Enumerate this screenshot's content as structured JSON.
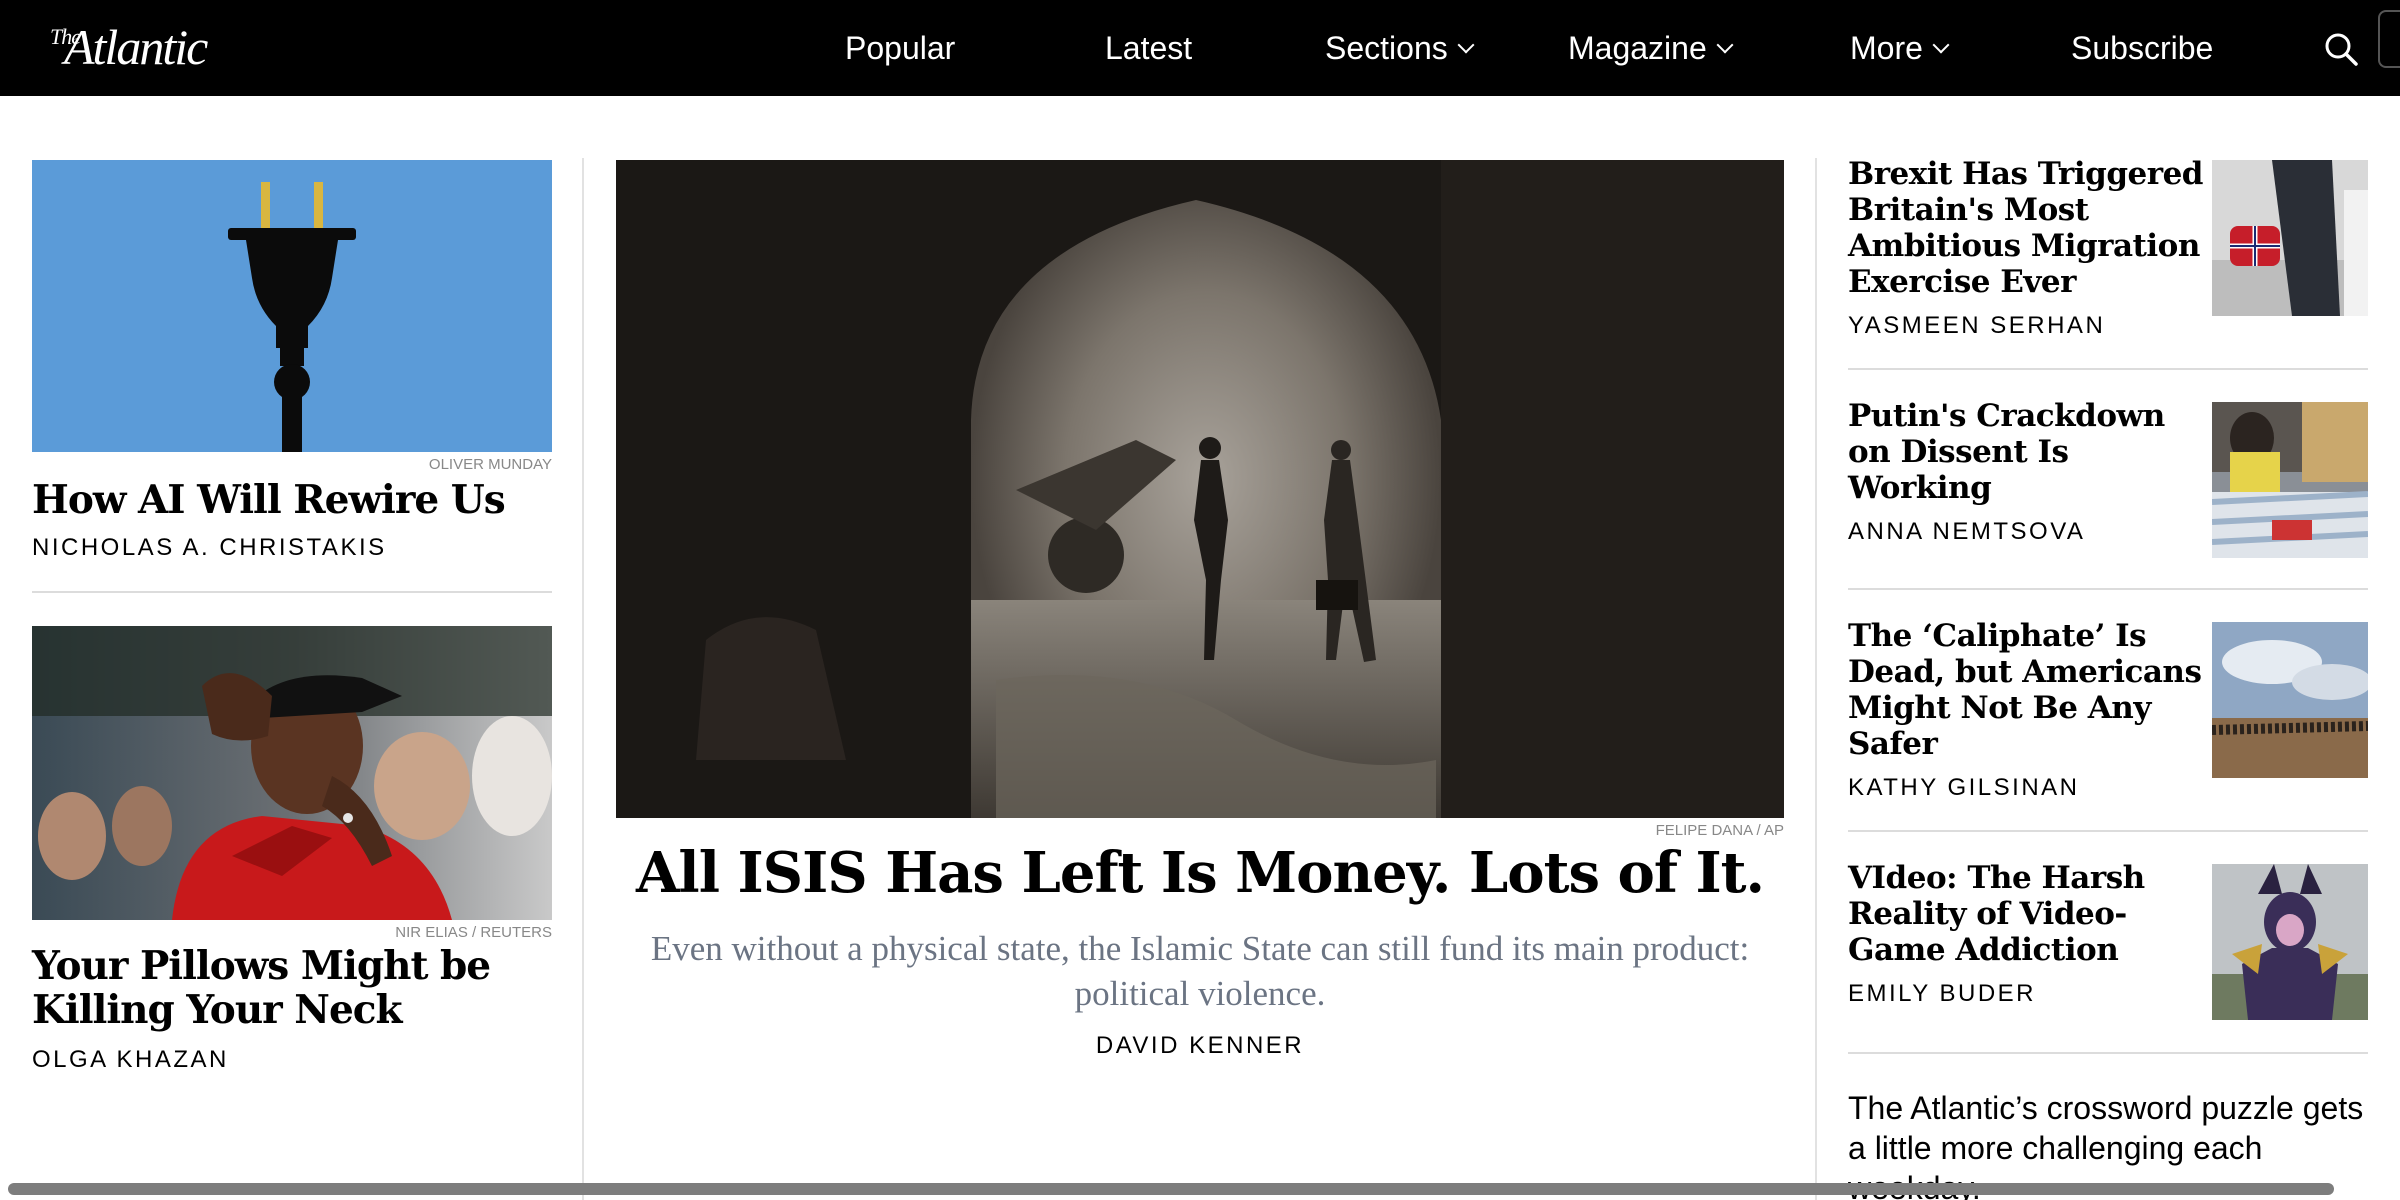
{
  "nav": {
    "logo_small": "The",
    "logo_name": "Atlantic",
    "items": [
      {
        "label": "Popular"
      },
      {
        "label": "Latest"
      },
      {
        "label": "Sections"
      },
      {
        "label": "Magazine"
      },
      {
        "label": "More"
      },
      {
        "label": "Subscribe"
      }
    ]
  },
  "left": {
    "story1": {
      "credit": "OLIVER MUNDAY",
      "headline": "How AI Will Rewire Us",
      "byline": "NICHOLAS A. CHRISTAKIS"
    },
    "story2": {
      "credit": "NIR ELIAS / REUTERS",
      "headline": "Your Pillows Might be Killing Your Neck",
      "byline": "OLGA KHAZAN"
    }
  },
  "main": {
    "credit": "FELIPE DANA / AP",
    "headline": "All ISIS Has Left Is Money. Lots of It.",
    "dek": "Even without a physical state, the Islamic State can still fund its main product: political violence.",
    "byline": "DAVID KENNER"
  },
  "right": {
    "stories": [
      {
        "headline": "Brexit Has Triggered Britain's Most Ambitious Migration Exercise Ever",
        "byline": "YASMEEN SERHAN"
      },
      {
        "headline": "Putin's Crackdown on Dissent Is Working",
        "byline": "ANNA NEMTSOVA"
      },
      {
        "headline": "The ‘Caliphate’ Is Dead, but Americans Might Not Be Any Safer",
        "byline": "KATHY GILSINAN"
      },
      {
        "headline": "VIdeo: The Harsh Reality of Video-Game Addiction",
        "byline": "EMILY BUDER"
      }
    ],
    "promo": "The Atlantic’s crossword puzzle gets a little more challenging each weekday."
  },
  "colors": {
    "nav_bg": "#000000",
    "dek_gray": "#6b7483",
    "rule_gray": "#e2e2e2",
    "plug_bg": "#5b9bd8"
  }
}
